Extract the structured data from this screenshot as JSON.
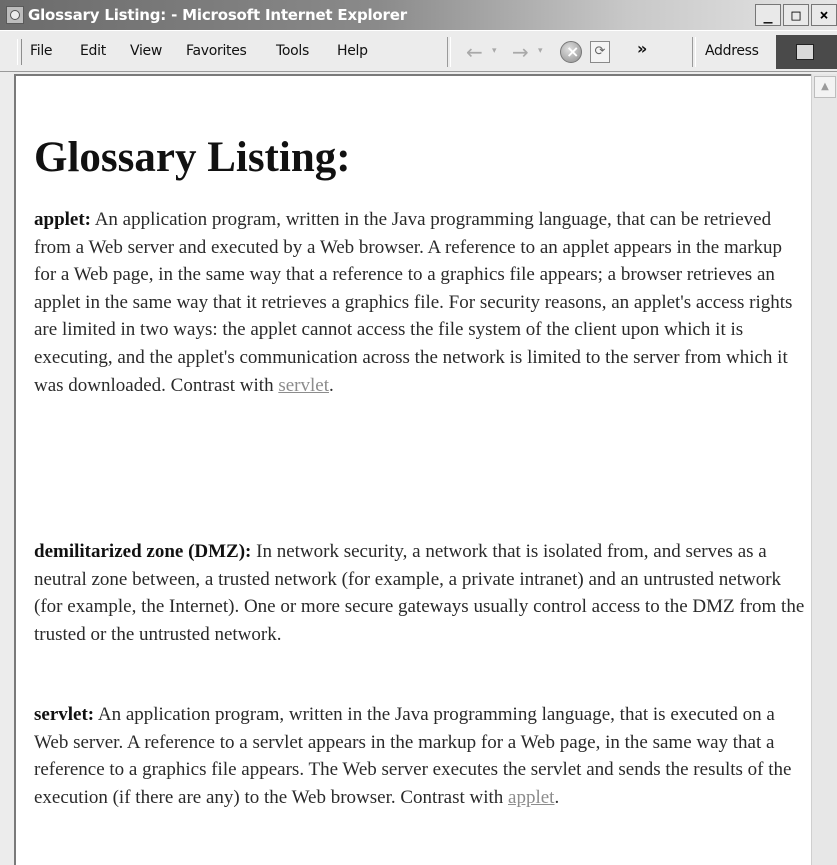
{
  "window": {
    "title": "Glossary Listing: - Microsoft Internet Explorer",
    "controls": {
      "minimize": "_",
      "maximize": "□",
      "close": "×"
    }
  },
  "menu": [
    "File",
    "Edit",
    "View",
    "Favorites",
    "Tools",
    "Help"
  ],
  "toolbar": {
    "back_icon": "←",
    "forward_icon": "→",
    "dropdown_icon": "▾",
    "more_icon": "»",
    "address_label": "Address",
    "refresh_icon": "⟳"
  },
  "page": {
    "heading": "Glossary Listing:",
    "entries": [
      {
        "term": "applet:",
        "definition": " An application program, written in the Java programming language, that can be retrieved from a Web server and executed by a Web browser. A reference to an applet appears in the markup for a Web page, in the same way that a reference to a graphics file appears; a browser retrieves an applet in the same way that it retrieves a graphics file. For security reasons, an applet's access rights are limited in two ways: the applet cannot access the file system of the client upon which it is executing, and the applet's communication across the network is limited to the server from which it was downloaded. Contrast with ",
        "link": "servlet",
        "end": "."
      },
      {
        "term": "demilitarized zone (DMZ):",
        "definition": " In network security, a network that is isolated from, and serves as a neutral zone between, a trusted network (for example, a private intranet) and an untrusted network (for example, the Internet). One or more secure gateways usually control access to the DMZ from the trusted or the untrusted network.",
        "link": "",
        "end": ""
      },
      {
        "term": "servlet:",
        "definition": " An application program, written in the Java programming language, that is executed on a Web server. A reference to a servlet appears in the markup for a Web page, in the same way that a reference to a graphics file appears. The Web server executes the servlet and sends the results of the execution (if there are any) to the Web browser. Contrast with ",
        "link": "applet",
        "end": "."
      }
    ]
  },
  "scrollbar": {
    "up_icon": "▲"
  }
}
